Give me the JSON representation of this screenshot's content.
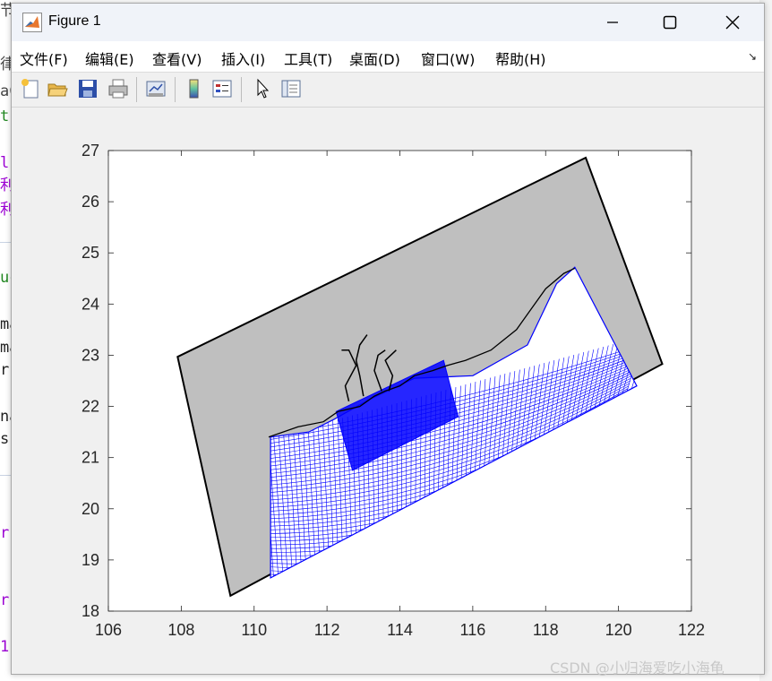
{
  "window": {
    "title": "Figure 1",
    "controls": {
      "minimize": "minimize-icon",
      "maximize": "maximize-icon",
      "close": "close-icon"
    }
  },
  "menu": {
    "items": [
      "文件(F)",
      "编辑(E)",
      "查看(V)",
      "插入(I)",
      "工具(T)",
      "桌面(D)",
      "窗口(W)",
      "帮助(H)"
    ]
  },
  "toolbar": {
    "buttons": [
      "new-figure-icon",
      "open-icon",
      "save-icon",
      "print-icon",
      "link-plot-icon",
      "colorbar-icon",
      "legend-icon",
      "edit-plot-icon",
      "property-inspector-icon"
    ]
  },
  "background_fragments": [
    "节",
    "律",
    "aC",
    "t",
    "l",
    "利",
    "利",
    "uc",
    "ma",
    "ma",
    "r",
    "na",
    "s",
    "r",
    "r",
    "r",
    "1"
  ],
  "chart_data": {
    "type": "map",
    "xlim": [
      106,
      122
    ],
    "ylim": [
      18,
      27
    ],
    "xticks": [
      "106",
      "108",
      "110",
      "112",
      "114",
      "116",
      "118",
      "120",
      "122"
    ],
    "yticks": [
      "18",
      "19",
      "20",
      "21",
      "22",
      "23",
      "24",
      "25",
      "26",
      "27"
    ],
    "xlabel": "",
    "ylabel": "",
    "title": "",
    "grid": false,
    "domain_polygon": {
      "fill": "#bfbfbf",
      "edge": "#000000",
      "vertices": [
        [
          107.9,
          22.97
        ],
        [
          119.1,
          26.86
        ],
        [
          121.2,
          22.83
        ],
        [
          109.35,
          18.3
        ]
      ]
    },
    "coastline_color": "#000000",
    "mesh_color": "#0000ff",
    "mesh_region": [
      [
        110.45,
        18.65
      ],
      [
        110.45,
        21.4
      ],
      [
        111.5,
        21.5
      ],
      [
        112.2,
        21.75
      ],
      [
        113.2,
        22.15
      ],
      [
        114.4,
        22.55
      ],
      [
        116,
        22.6
      ],
      [
        117.5,
        23.2
      ],
      [
        118.3,
        24.4
      ],
      [
        118.8,
        24.72
      ],
      [
        120.5,
        22.4
      ]
    ],
    "refined_patch": [
      [
        112.25,
        21.9
      ],
      [
        115.2,
        22.9
      ],
      [
        115.6,
        21.8
      ],
      [
        112.7,
        20.75
      ]
    ]
  },
  "watermark": "CSDN @小归海爱吃小海龟"
}
